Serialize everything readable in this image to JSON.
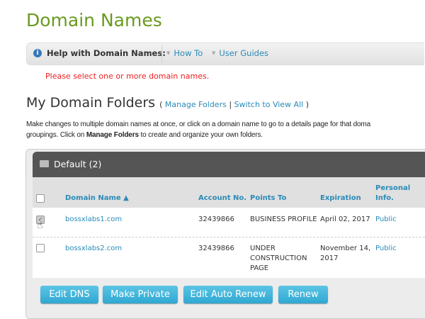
{
  "title": "Domain Names",
  "help": {
    "label": "Help with Domain Names:",
    "links": [
      "How To",
      "User Guides"
    ]
  },
  "error": "Please select one or more domain names.",
  "folders": {
    "heading": "My Domain Folders",
    "open": "(",
    "manage": "Manage Folders",
    "sep": "|",
    "switch": "Switch to View All",
    "close": ")"
  },
  "desc": {
    "line1": "Make changes to multiple domain names at once, or click on a domain name to go to a details page for that doma",
    "line2_a": "groupings. Click on ",
    "line2_b": "Manage Folders",
    "line2_c": " to create and organize your own folders."
  },
  "folder": {
    "name": "Default (2)"
  },
  "columns": [
    "Domain Name ▲",
    "Account No.",
    "Points To",
    "Expiration",
    "Personal Info."
  ],
  "rows": [
    {
      "domain": "bossxlabs1.com",
      "account": "32439866",
      "points": "BUSINESS PROFILE",
      "expiration": "April 02, 2017",
      "privacy": "Public",
      "checked": true
    },
    {
      "domain": "bossxlabs2.com",
      "account": "32439866",
      "points": "UNDER CONSTRUCTION PAGE",
      "expiration": "November 14, 2017",
      "privacy": "Public",
      "checked": false
    }
  ],
  "buttons": [
    "Edit DNS",
    "Make Private",
    "Edit Auto Renew",
    "Renew"
  ]
}
